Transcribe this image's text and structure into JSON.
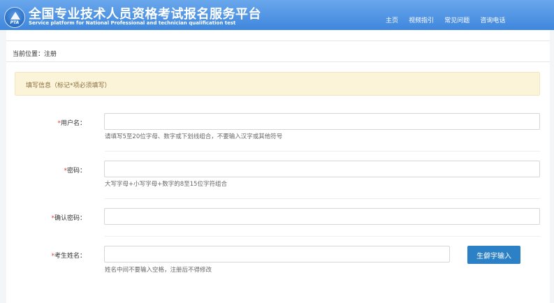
{
  "header": {
    "logo_text": "PTA",
    "title": "全国专业技术人员资格考试报名服务平台",
    "subtitle": "Service platform for National Professional and technician qualification test",
    "nav": [
      "主页",
      "视频指引",
      "常见问题",
      "咨询电话"
    ]
  },
  "breadcrumb": "当前位置：注册",
  "notice": "填写信息（标记*项必须填写）",
  "form": {
    "username": {
      "required_mark": "*",
      "label": "用户名：",
      "value": "",
      "hint": "请填写5至20位字母、数字或下划线组合，不要输入汉字或其他符号"
    },
    "password": {
      "required_mark": "*",
      "label": "密码：",
      "value": "",
      "hint": "大写字母+小写字母+数字的8至15位字符组合"
    },
    "confirm_password": {
      "required_mark": "*",
      "label": "确认密码：",
      "value": ""
    },
    "name": {
      "required_mark": "*",
      "label": "考生姓名：",
      "value": "",
      "hint": "姓名中间不要输入空格，注册后不得修改"
    },
    "rare_char_button": "生僻字输入"
  },
  "colors": {
    "header": "#4a8fe2",
    "notice_bg": "#fcf4d9",
    "required": "#e53935",
    "button": "#2c80c6"
  }
}
